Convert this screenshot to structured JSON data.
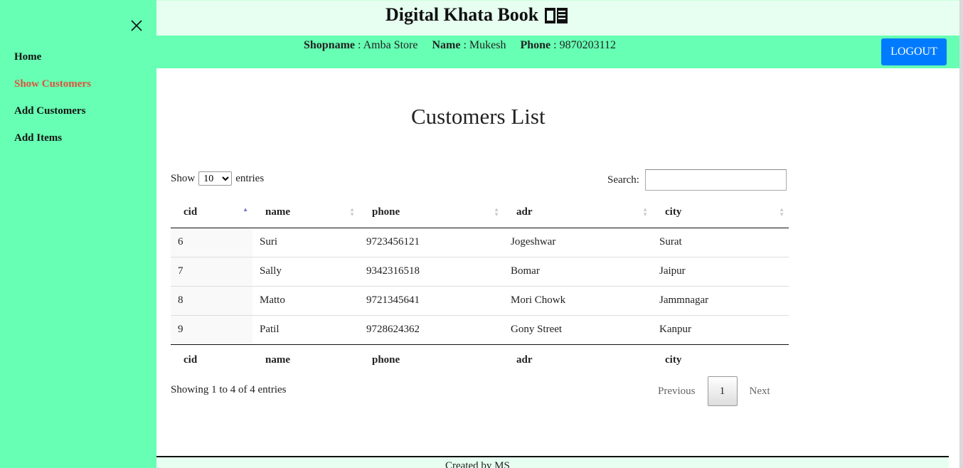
{
  "sidebar": {
    "items": [
      {
        "label": "Home"
      },
      {
        "label": "Show Customers"
      },
      {
        "label": "Add Customers"
      },
      {
        "label": "Add Items"
      }
    ],
    "active_color": "#e0503d"
  },
  "header": {
    "title": "Digital Khata Book",
    "title_icon": "book-icon",
    "shopname_label": "Shopname",
    "shopname_value": "Amba Store",
    "name_label": "Name",
    "name_value": "Mukesh",
    "phone_label": "Phone",
    "phone_value": "9870203112",
    "logout_label": "LOGOUT"
  },
  "main": {
    "title": "Customers List",
    "show_label": "Show",
    "entries_label": "entries",
    "page_length": "10",
    "search_label": "Search:",
    "search_value": "",
    "columns": [
      "cid",
      "name",
      "phone",
      "adr",
      "city"
    ],
    "rows": [
      [
        "6",
        "Suri",
        "9723456121",
        "Jogeshwar",
        "Surat"
      ],
      [
        "7",
        "Sally",
        "9342316518",
        "Bomar",
        "Jaipur"
      ],
      [
        "8",
        "Matto",
        "9721345641",
        "Mori Chowk",
        "Jammnagar"
      ],
      [
        "9",
        "Patil",
        "9728624362",
        "Gony Street",
        "Kanpur"
      ]
    ],
    "info": "Showing 1 to 4 of 4 entries",
    "pagination": {
      "previous": "Previous",
      "current": "1",
      "next": "Next"
    }
  },
  "footer": {
    "text": "Created by MS"
  },
  "colors": {
    "sidebar": "#66ffb3",
    "header_bg": "#e6fff0",
    "logout_bg": "#007bff"
  }
}
